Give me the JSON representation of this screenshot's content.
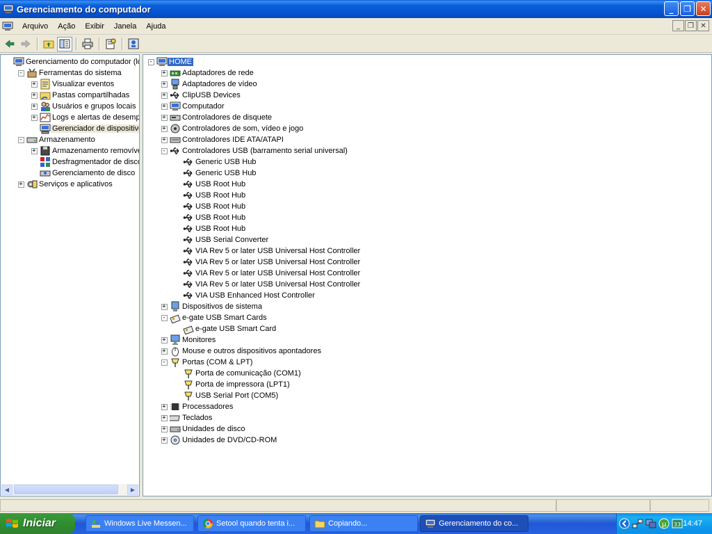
{
  "window": {
    "title": "Gerenciamento do computador"
  },
  "menu": [
    "Arquivo",
    "Ação",
    "Exibir",
    "Janela",
    "Ajuda"
  ],
  "left_tree": [
    {
      "label": "Gerenciamento do computador (local",
      "level": 0,
      "expander": "",
      "icon": "computer-management-icon"
    },
    {
      "label": "Ferramentas do sistema",
      "level": 1,
      "expander": "-",
      "icon": "system-tools-icon"
    },
    {
      "label": "Visualizar eventos",
      "level": 2,
      "expander": "+",
      "icon": "event-viewer-icon"
    },
    {
      "label": "Pastas compartilhadas",
      "level": 2,
      "expander": "+",
      "icon": "shared-folder-icon"
    },
    {
      "label": "Usuários e grupos locais",
      "level": 2,
      "expander": "+",
      "icon": "users-icon"
    },
    {
      "label": "Logs e alertas de desempenh",
      "level": 2,
      "expander": "+",
      "icon": "performance-logs-icon"
    },
    {
      "label": "Gerenciador de dispositivos",
      "level": 2,
      "expander": "",
      "icon": "device-manager-icon",
      "selected": true
    },
    {
      "label": "Armazenamento",
      "level": 1,
      "expander": "-",
      "icon": "storage-icon"
    },
    {
      "label": "Armazenamento removível",
      "level": 2,
      "expander": "+",
      "icon": "removable-storage-icon"
    },
    {
      "label": "Desfragmentador de disco",
      "level": 2,
      "expander": "",
      "icon": "defrag-icon"
    },
    {
      "label": "Gerenciamento de disco",
      "level": 2,
      "expander": "",
      "icon": "disk-management-icon"
    },
    {
      "label": "Serviços e aplicativos",
      "level": 1,
      "expander": "+",
      "icon": "services-icon"
    }
  ],
  "device_tree": [
    {
      "label": "HOME",
      "level": 0,
      "expander": "-",
      "icon": "computer-icon",
      "selected": true
    },
    {
      "label": "Adaptadores de rede",
      "level": 1,
      "expander": "+",
      "icon": "network-adapter-icon"
    },
    {
      "label": "Adaptadores de vídeo",
      "level": 1,
      "expander": "+",
      "icon": "display-adapter-icon"
    },
    {
      "label": "ClipUSB Devices",
      "level": 1,
      "expander": "+",
      "icon": "usb-icon"
    },
    {
      "label": "Computador",
      "level": 1,
      "expander": "+",
      "icon": "computer-icon"
    },
    {
      "label": "Controladores de disquete",
      "level": 1,
      "expander": "+",
      "icon": "floppy-controller-icon"
    },
    {
      "label": "Controladores de som, vídeo e jogo",
      "level": 1,
      "expander": "+",
      "icon": "sound-icon"
    },
    {
      "label": "Controladores IDE ATA/ATAPI",
      "level": 1,
      "expander": "+",
      "icon": "ide-controller-icon"
    },
    {
      "label": "Controladores USB (barramento serial universal)",
      "level": 1,
      "expander": "-",
      "icon": "usb-icon"
    },
    {
      "label": "Generic USB Hub",
      "level": 2,
      "expander": "",
      "icon": "usb-icon"
    },
    {
      "label": "Generic USB Hub",
      "level": 2,
      "expander": "",
      "icon": "usb-icon"
    },
    {
      "label": "USB Root Hub",
      "level": 2,
      "expander": "",
      "icon": "usb-icon"
    },
    {
      "label": "USB Root Hub",
      "level": 2,
      "expander": "",
      "icon": "usb-icon"
    },
    {
      "label": "USB Root Hub",
      "level": 2,
      "expander": "",
      "icon": "usb-icon"
    },
    {
      "label": "USB Root Hub",
      "level": 2,
      "expander": "",
      "icon": "usb-icon"
    },
    {
      "label": "USB Root Hub",
      "level": 2,
      "expander": "",
      "icon": "usb-icon"
    },
    {
      "label": "USB Serial Converter",
      "level": 2,
      "expander": "",
      "icon": "usb-icon"
    },
    {
      "label": "VIA Rev 5 or later USB Universal Host Controller",
      "level": 2,
      "expander": "",
      "icon": "usb-icon"
    },
    {
      "label": "VIA Rev 5 or later USB Universal Host Controller",
      "level": 2,
      "expander": "",
      "icon": "usb-icon"
    },
    {
      "label": "VIA Rev 5 or later USB Universal Host Controller",
      "level": 2,
      "expander": "",
      "icon": "usb-icon"
    },
    {
      "label": "VIA Rev 5 or later USB Universal Host Controller",
      "level": 2,
      "expander": "",
      "icon": "usb-icon"
    },
    {
      "label": "VIA USB Enhanced Host Controller",
      "level": 2,
      "expander": "",
      "icon": "usb-icon"
    },
    {
      "label": "Dispositivos de sistema",
      "level": 1,
      "expander": "+",
      "icon": "system-device-icon"
    },
    {
      "label": "e-gate USB Smart Cards",
      "level": 1,
      "expander": "-",
      "icon": "smart-card-icon"
    },
    {
      "label": "e-gate USB Smart Card",
      "level": 2,
      "expander": "",
      "icon": "smart-card-icon"
    },
    {
      "label": "Monitores",
      "level": 1,
      "expander": "+",
      "icon": "monitor-icon"
    },
    {
      "label": "Mouse e outros dispositivos apontadores",
      "level": 1,
      "expander": "+",
      "icon": "mouse-icon"
    },
    {
      "label": "Portas (COM & LPT)",
      "level": 1,
      "expander": "-",
      "icon": "port-icon"
    },
    {
      "label": "Porta de comunicação (COM1)",
      "level": 2,
      "expander": "",
      "icon": "port-icon"
    },
    {
      "label": "Porta de impressora (LPT1)",
      "level": 2,
      "expander": "",
      "icon": "port-icon"
    },
    {
      "label": "USB Serial Port (COM5)",
      "level": 2,
      "expander": "",
      "icon": "port-icon"
    },
    {
      "label": "Processadores",
      "level": 1,
      "expander": "+",
      "icon": "processor-icon"
    },
    {
      "label": "Teclados",
      "level": 1,
      "expander": "+",
      "icon": "keyboard-icon"
    },
    {
      "label": "Unidades de disco",
      "level": 1,
      "expander": "+",
      "icon": "disk-drive-icon"
    },
    {
      "label": "Unidades de DVD/CD-ROM",
      "level": 1,
      "expander": "+",
      "icon": "cdrom-icon"
    }
  ],
  "taskbar": {
    "start_label": "Iniciar",
    "tasks": [
      {
        "label": "Windows Live Messen...",
        "icon": "messenger-icon"
      },
      {
        "label": "Setool quando tenta i...",
        "icon": "chrome-icon"
      },
      {
        "label": "Copiando...",
        "icon": "folder-icon"
      },
      {
        "label": "Gerenciamento do co...",
        "icon": "computer-management-icon",
        "active": true
      }
    ],
    "clock": "14:47"
  }
}
